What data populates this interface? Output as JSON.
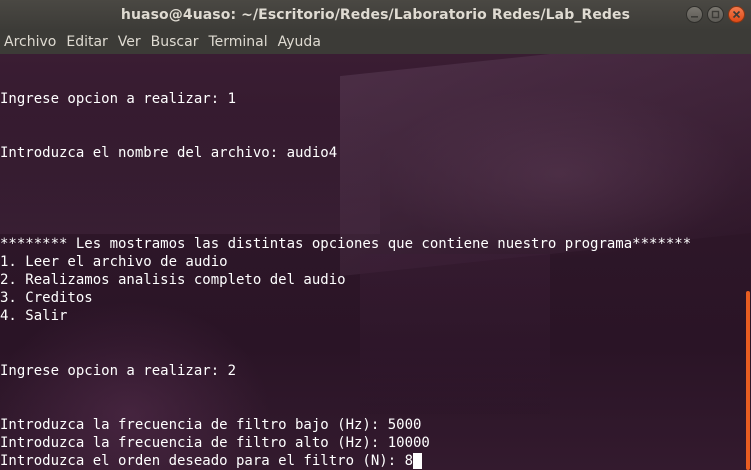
{
  "window": {
    "title": "huaso@4uaso: ~/Escritorio/Redes/Laboratorio Redes/Lab_Redes",
    "controls": [
      "minimize-icon",
      "maximize-icon",
      "close-icon"
    ]
  },
  "menu": {
    "items": [
      "Archivo",
      "Editar",
      "Ver",
      "Buscar",
      "Terminal",
      "Ayuda"
    ]
  },
  "terminal": {
    "lines": [
      "",
      "",
      "Ingrese opcion a realizar: 1",
      "",
      "",
      "Introduzca el nombre del archivo: audio4",
      "",
      "",
      "",
      "",
      "******** Les mostramos las distintas opciones que contiene nuestro programa*******",
      "1. Leer el archivo de audio",
      "2. Realizamos analisis completo del audio",
      "3. Creditos",
      "4. Salir",
      "",
      "",
      "Ingrese opcion a realizar: 2",
      "",
      "",
      "Introduzca la frecuencia de filtro bajo (Hz): 5000",
      "Introduzca la frecuencia de filtro alto (Hz): 10000"
    ],
    "prompt_line": "Introduzca el orden deseado para el filtro (N): 8"
  },
  "colors": {
    "titlebar": "#3c3b37",
    "terminal_bg": "#2c1426",
    "text": "#ffffff",
    "scroll_thumb": "#e85d21",
    "close_button": "#df4a16"
  }
}
